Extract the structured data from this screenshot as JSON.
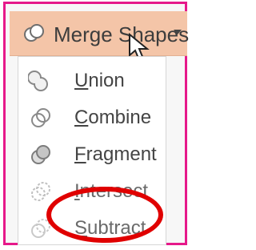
{
  "header": {
    "label": "Merge Shapes",
    "icon": "merge-shapes-icon",
    "dropdown_icon": "dropdown-arrow-icon"
  },
  "menu": {
    "items": [
      {
        "label": "Union",
        "icon": "union-icon"
      },
      {
        "label": "Combine",
        "icon": "combine-icon"
      },
      {
        "label": "Fragment",
        "icon": "fragment-icon"
      },
      {
        "label": "Intersect",
        "icon": "intersect-icon"
      },
      {
        "label": "Subtract",
        "icon": "subtract-icon"
      }
    ]
  },
  "annotation": {
    "highlight_color": "#e00000",
    "frame_color": "#e6198a"
  }
}
